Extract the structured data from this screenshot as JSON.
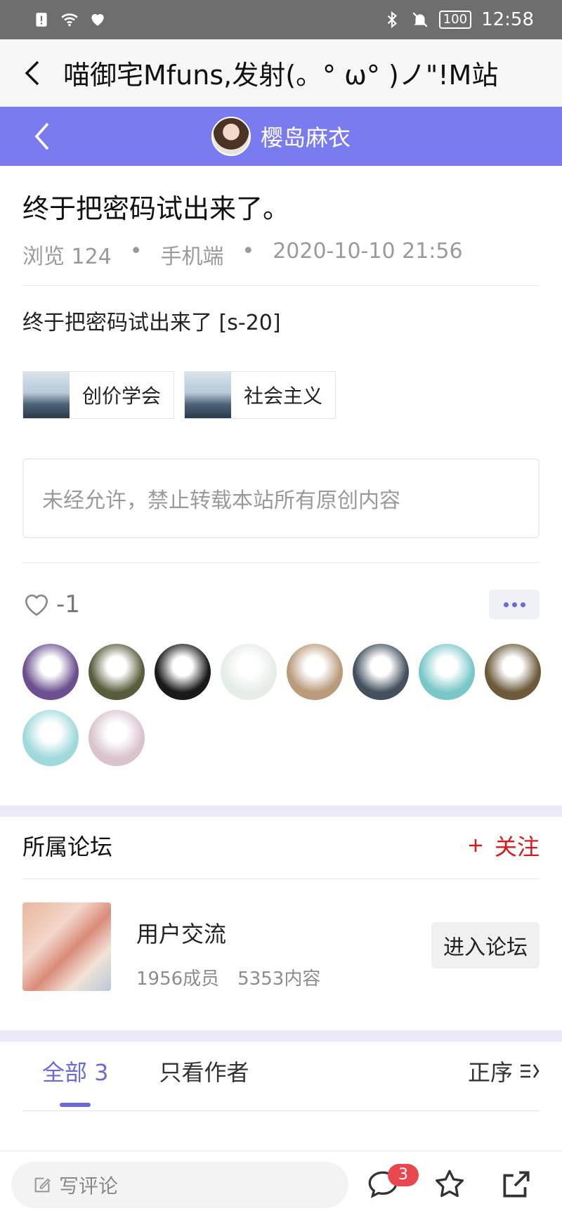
{
  "status_bar": {
    "time": "12:58",
    "battery": "100"
  },
  "top_bar": {
    "title": "喵御宅Mfuns,发射(。° ω° )ノ\"!M站"
  },
  "header": {
    "author_name": "樱岛麻衣"
  },
  "post": {
    "title": "终于把密码试出来了。",
    "views_label": "浏览 124",
    "separator": "•",
    "client": "手机端",
    "datetime": "2020-10-10 21:56",
    "body": "终于把密码试出来了 [s-20]",
    "tags": [
      {
        "label": "创价学会"
      },
      {
        "label": "社会主义"
      }
    ],
    "notice": "未经允许，禁止转载本站所有原创内容",
    "like_count": "-1"
  },
  "likers": [
    {
      "color": "#6b4f8f"
    },
    {
      "color": "#5a5c3c"
    },
    {
      "color": "#1a1a1a"
    },
    {
      "color": "#e6ece8"
    },
    {
      "color": "#b99a7a"
    },
    {
      "color": "#44505e"
    },
    {
      "color": "#7ac7c9"
    },
    {
      "color": "#6c5a3a"
    },
    {
      "color": "#9fd9dc"
    },
    {
      "color": "#d9c3cf"
    }
  ],
  "forum": {
    "section_title": "所属论坛",
    "follow_label": "关注",
    "name": "用户交流",
    "members": "1956成员",
    "contents": "5353内容",
    "enter_label": "进入论坛"
  },
  "comments_tabs": {
    "all_label": "全部 3",
    "author_only_label": "只看作者",
    "sort_label": "正序"
  },
  "bottom_bar": {
    "comment_placeholder": "写评论",
    "comment_count": "3"
  },
  "colors": {
    "accent": "#7b7bf0",
    "follow_red": "#d7181c",
    "badge": "#e8484d"
  }
}
